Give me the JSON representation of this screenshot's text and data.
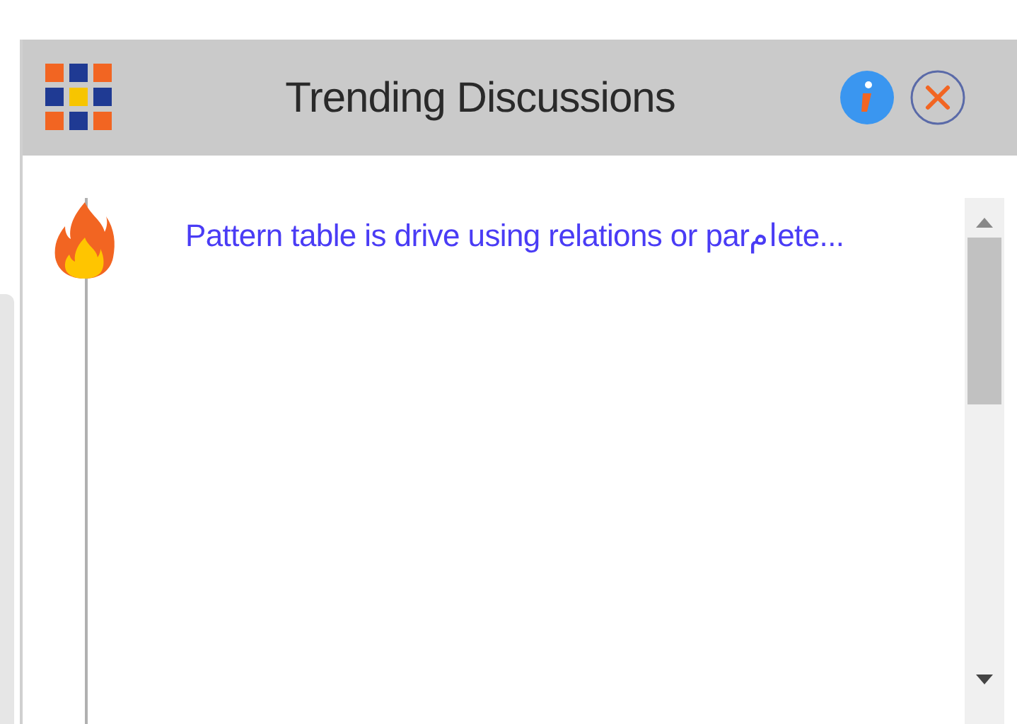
{
  "panel": {
    "title": "Trending Discussions"
  },
  "discussions": [
    {
      "title": "Pattern table is drive using relations or parامete..."
    }
  ]
}
